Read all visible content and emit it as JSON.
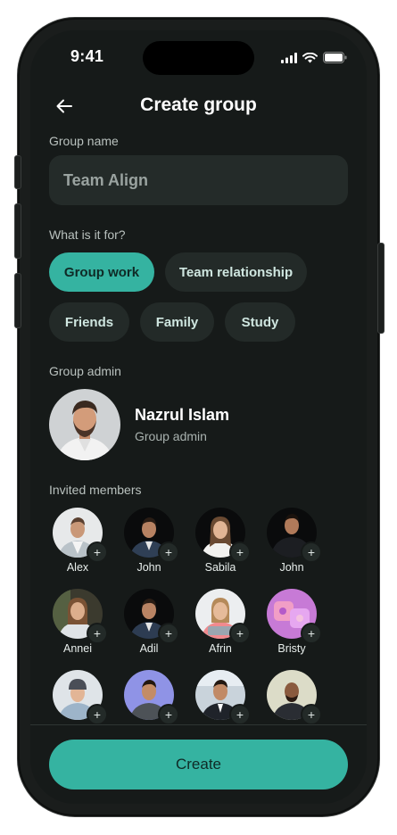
{
  "status_bar": {
    "time": "9:41"
  },
  "header": {
    "title": "Create group"
  },
  "group_name": {
    "label": "Group name",
    "value": "Team Align"
  },
  "purpose": {
    "label": "What is it for?",
    "chips": [
      "Group work",
      "Team relationship",
      "Friends",
      "Family",
      "Study"
    ],
    "selected": "Group work"
  },
  "admin": {
    "label": "Group admin",
    "name": "Nazrul Islam",
    "role": "Group admin"
  },
  "members": {
    "label": "Invited members",
    "list": [
      "Alex",
      "John",
      "Sabila",
      "John",
      "Annei",
      "Adil",
      "Afrin",
      "Bristy",
      "",
      "",
      "",
      ""
    ]
  },
  "actions": {
    "create_label": "Create"
  },
  "colors": {
    "accent": "#35b3a1",
    "background": "#161a19",
    "surface": "#242b29",
    "chip": "#232a28"
  },
  "icons": {
    "back": "arrow-left-icon",
    "add": "plus-icon",
    "signal": "signal-icon",
    "wifi": "wifi-icon",
    "battery": "battery-icon"
  }
}
